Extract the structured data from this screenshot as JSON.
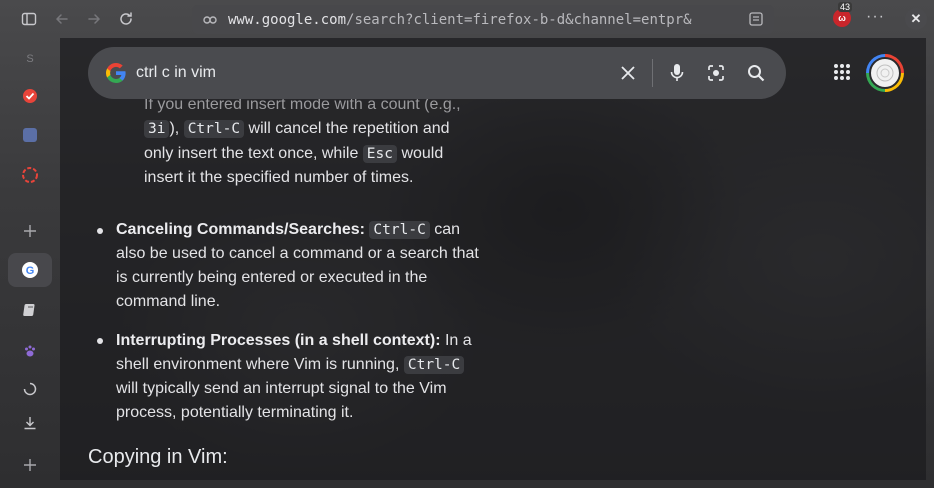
{
  "browser": {
    "url_host": "www.google.com",
    "url_path": "/search?client=firefox-b-d&channel=entpr&",
    "extension_badge": "43",
    "sidebar_letter": "S"
  },
  "search": {
    "query": "ctrl c in vim"
  },
  "content": {
    "cut_line": "If you entered insert mode with a count (e.g.,",
    "p1_code1": "3i",
    "p1_text1": "),",
    "p1_code2": "Ctrl-C",
    "p1_text2": " will cancel the repetition and",
    "p1_line2a": "only insert the text once, while",
    "p1_code3": "Esc",
    "p1_line2b": " would",
    "p1_line3": "insert it the specified number of times.",
    "b1_title": "Canceling Commands/Searches:",
    "b1_code": "Ctrl-C",
    "b1_after": " can",
    "b1_line2": "also be used to cancel a command or a search that",
    "b1_line3": "is currently being entered or executed in the",
    "b1_line4": "command line.",
    "b2_title": "Interrupting Processes (in a shell context):",
    "b2_after": " In a",
    "b2_line2": "shell environment where Vim is running,",
    "b2_code": "Ctrl-C",
    "b2_line3": "will typically send an interrupt signal to the Vim",
    "b2_line4": "process, potentially terminating it.",
    "heading": "Copying in Vim:"
  }
}
